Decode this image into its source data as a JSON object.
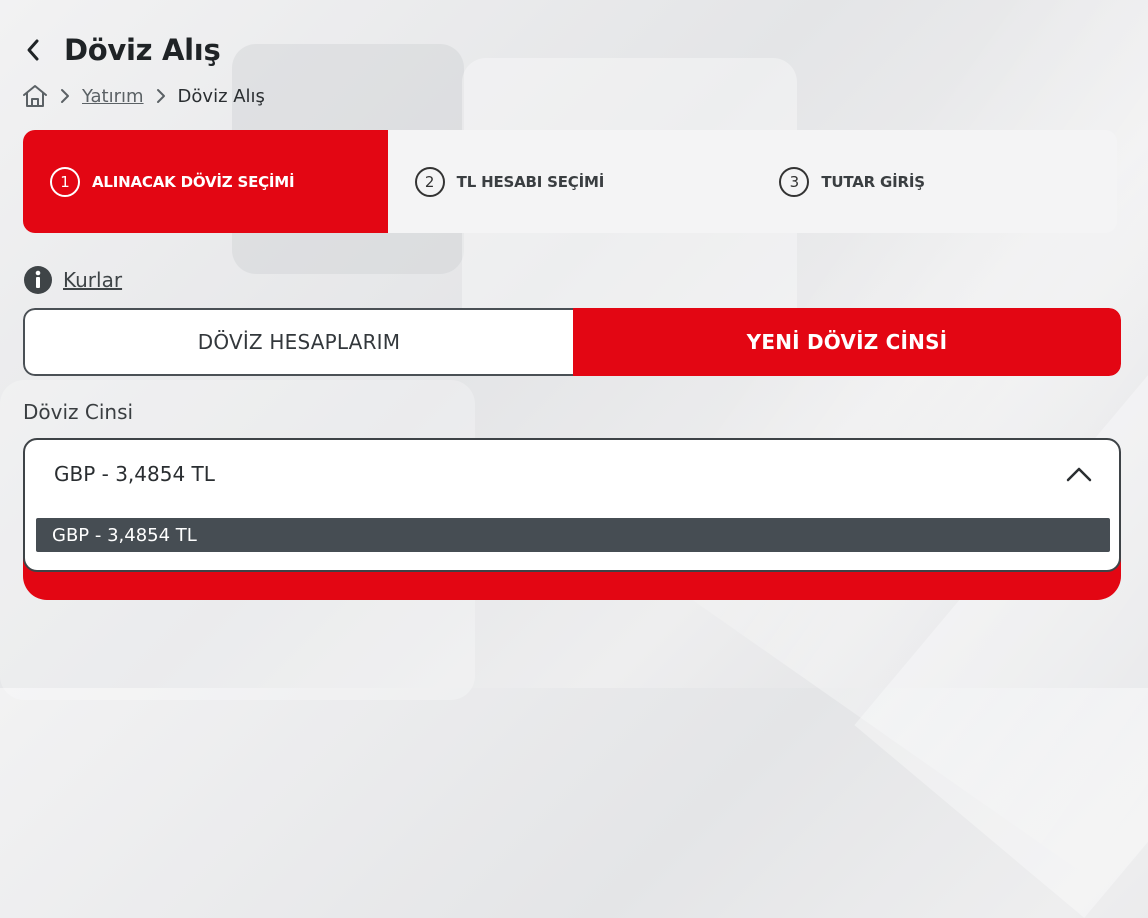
{
  "header": {
    "title": "Döviz Alış",
    "back_icon": "chevron-left-icon"
  },
  "breadcrumb": {
    "home_icon": "home-icon",
    "items": [
      "Yatırım",
      "Döviz Alış"
    ]
  },
  "steps": [
    {
      "num": "1",
      "label": "ALINACAK DÖVİZ SEÇİMİ",
      "active": true
    },
    {
      "num": "2",
      "label": "TL HESABI SEÇİMİ",
      "active": false
    },
    {
      "num": "3",
      "label": "TUTAR GİRİŞ",
      "active": false
    }
  ],
  "rates": {
    "icon": "info-icon",
    "label": "Kurlar"
  },
  "segment": {
    "tab1": "DÖVİZ HESAPLARIM",
    "tab2": "YENİ DÖVİZ CİNSİ",
    "active": "tab2"
  },
  "currency": {
    "label": "Döviz Cinsi",
    "selected": "GBP - 3,4854 TL",
    "options": [
      "GBP - 3,4854 TL"
    ]
  },
  "colors": {
    "accent": "#e30613",
    "dark": "#464d53"
  }
}
